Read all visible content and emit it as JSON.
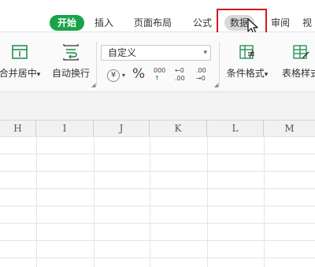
{
  "tabs": [
    {
      "label": "开始",
      "name": "tab-home"
    },
    {
      "label": "插入",
      "name": "tab-insert"
    },
    {
      "label": "页面布局",
      "name": "tab-page-layout"
    },
    {
      "label": "公式",
      "name": "tab-formulas"
    },
    {
      "label": "数据",
      "name": "tab-data"
    },
    {
      "label": "审阅",
      "name": "tab-review"
    },
    {
      "label": "视",
      "name": "tab-view"
    }
  ],
  "ribbon": {
    "merge_label": "合并居中",
    "merge_arrow": "▾",
    "wrap_label": "自动换行",
    "number_format_value": "自定义",
    "currency_symbol": "¥",
    "percent_symbol": "%",
    "thousands_symbol": "000",
    "increase_decimal": "←0 .00",
    "decrease_decimal": ".00 →0",
    "cond_format_label": "条件格式",
    "table_style_label": "表格样式"
  },
  "columns": [
    "H",
    "I",
    "J",
    "K",
    "L",
    "M"
  ],
  "colors": {
    "active_tab": "#1aa34a",
    "highlight_box": "#d0191f"
  }
}
